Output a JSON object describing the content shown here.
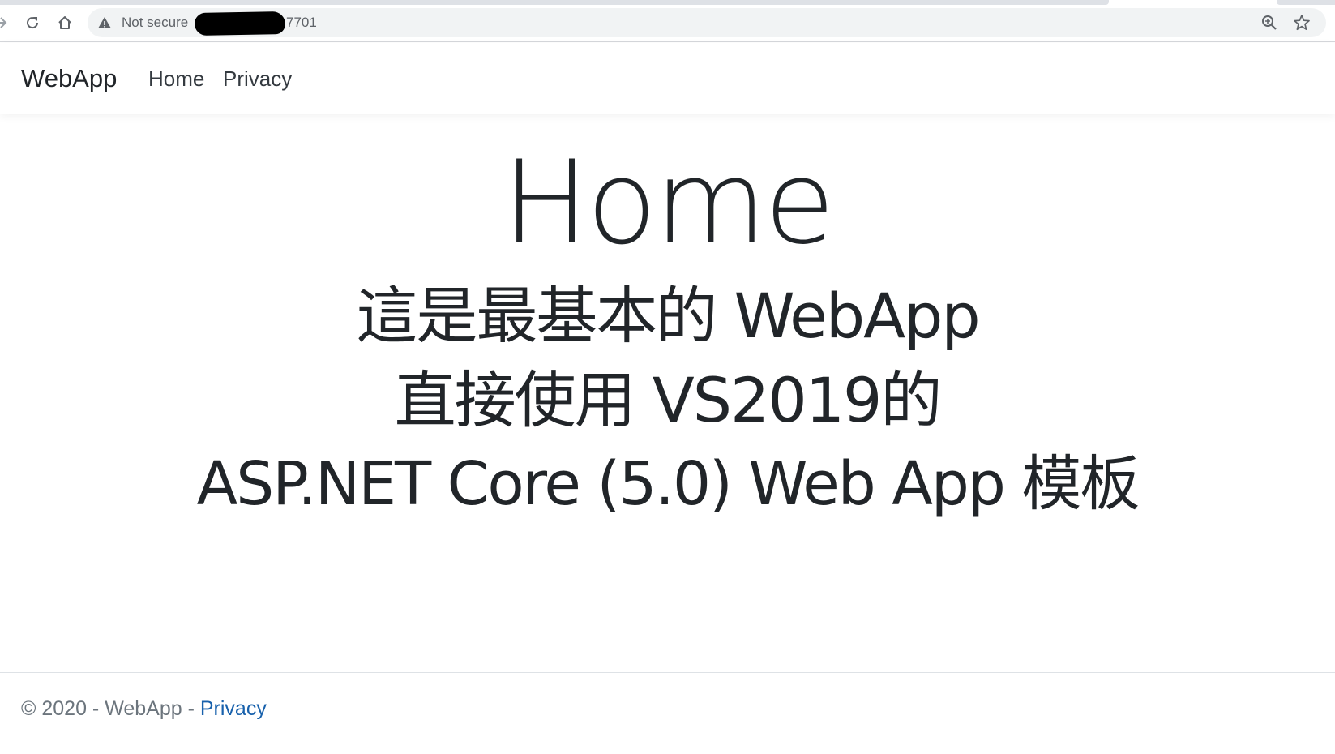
{
  "browser": {
    "security_label": "Not secure",
    "url_visible_suffix": "7701",
    "icons": [
      "back-arrow-icon",
      "reload-icon",
      "home-icon",
      "warning-triangle-icon",
      "zoom-icon",
      "star-icon"
    ]
  },
  "navbar": {
    "brand": "WebApp",
    "links": [
      {
        "label": "Home"
      },
      {
        "label": "Privacy"
      }
    ]
  },
  "main": {
    "title": "Home",
    "lines": [
      "這是最基本的 WebApp",
      "直接使用 VS2019的",
      "ASP.NET Core (5.0) Web App 模板"
    ]
  },
  "footer": {
    "copyright": "© 2020 - WebApp - ",
    "privacy_link": "Privacy"
  },
  "colors": {
    "text": "#212529",
    "muted": "#6c757d",
    "link": "#1861ac",
    "border": "#dee2e6",
    "omnibox": "#f1f3f4"
  }
}
